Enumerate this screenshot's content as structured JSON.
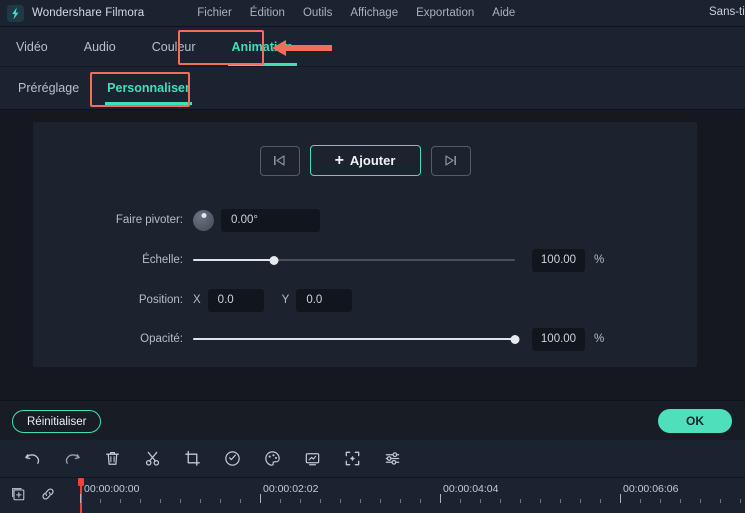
{
  "titlebar": {
    "app_name": "Wondershare Filmora",
    "logo_icon": "filmora-logo-icon",
    "menus": [
      "Fichier",
      "Édition",
      "Outils",
      "Affichage",
      "Exportation",
      "Aide"
    ],
    "project_name": "Sans-titre"
  },
  "tabs": [
    {
      "label": "Vidéo",
      "active": false
    },
    {
      "label": "Audio",
      "active": false
    },
    {
      "label": "Couleur",
      "active": false
    },
    {
      "label": "Animation",
      "active": true
    }
  ],
  "subtabs": [
    {
      "label": "Préréglage",
      "active": false
    },
    {
      "label": "Personnaliser",
      "active": true
    }
  ],
  "panel": {
    "keyframe": {
      "prev_label": "|<",
      "next_label": ">|",
      "add_label": "Ajouter",
      "add_plus": "+"
    },
    "properties": {
      "rotate": {
        "label": "Faire pivoter:",
        "value": "0.00°",
        "dial_angle": 0
      },
      "scale": {
        "label": "Échelle:",
        "value": "100.00",
        "unit": "%",
        "slider_pct": 25
      },
      "position": {
        "label": "Position:",
        "x_axis": "X",
        "x_value": "0.0",
        "y_axis": "Y",
        "y_value": "0.0"
      },
      "opacity": {
        "label": "Opacité:",
        "value": "100.00",
        "unit": "%",
        "slider_pct": 100
      }
    }
  },
  "footer": {
    "reset_label": "Réinitialiser",
    "ok_label": "OK"
  },
  "toolbar": {
    "icons": [
      "undo-icon",
      "redo-icon",
      "delete-icon",
      "cut-icon",
      "crop-icon",
      "speed-icon",
      "color-palette-icon",
      "snapshot-icon",
      "crop-to-fit-icon",
      "adjust-sliders-icon"
    ]
  },
  "timeline": {
    "icons": [
      "add-track-icon",
      "link-icon"
    ],
    "timecodes": [
      "00:00:00:00",
      "00:00:02:02",
      "00:00:04:04",
      "00:00:06:06"
    ],
    "playhead_position": "00:00:00:00"
  },
  "annotations": {
    "animation_box": "highlight-animation-tab",
    "personnaliser_box": "highlight-personnaliser-tab",
    "arrow": "left-pointing-arrow"
  },
  "colors": {
    "accent": "#3fe0b8",
    "ok_button": "#4fe0bb",
    "annotation": "#f26d5b",
    "playhead": "#f2442c",
    "panel_bg": "#1c222e",
    "chrome_bg": "#1b2230",
    "app_bg": "#15181f"
  }
}
